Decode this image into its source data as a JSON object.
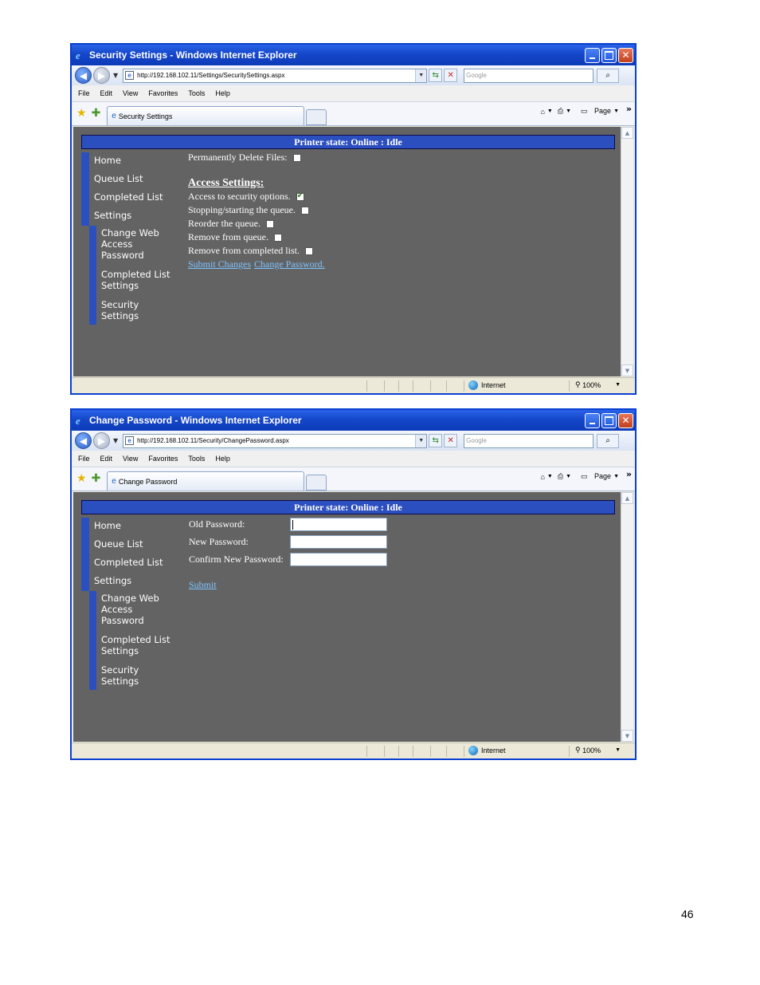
{
  "colors": {
    "title_bar": "#1547c9",
    "page_background": "#636363",
    "accent_blue": "#2c4fc0",
    "link": "#7ec3ff"
  },
  "windows": [
    {
      "title": "Security Settings - Windows Internet Explorer",
      "url": "http://192.168.102.11/Settings/SecuritySettings.aspx",
      "search_placeholder": "Google",
      "menu": [
        "File",
        "Edit",
        "View",
        "Favorites",
        "Tools",
        "Help"
      ],
      "tab_label": "Security Settings",
      "page_menu": "Page",
      "printer_state": "Printer state: Online : Idle",
      "nav": {
        "items": [
          "Home",
          "Queue List",
          "Completed List",
          "Settings"
        ],
        "sub_items": [
          "Change Web Access Password",
          "Completed List Settings",
          "Security Settings"
        ]
      },
      "content": {
        "permanent_delete_label": "Permanently Delete Files:",
        "permanent_delete_checked": false,
        "access_title": "Access Settings:",
        "options": [
          {
            "label": "Access to security options.",
            "checked": true
          },
          {
            "label": "Stopping/starting the queue.",
            "checked": false
          },
          {
            "label": "Reorder the queue.",
            "checked": false
          },
          {
            "label": "Remove from queue.",
            "checked": false
          },
          {
            "label": "Remove from completed list.",
            "checked": false
          }
        ],
        "submit_link": "Submit Changes",
        "change_password_link": "Change Password."
      },
      "status": {
        "zone": "Internet",
        "zoom": "100%"
      }
    },
    {
      "title": "Change Password - Windows Internet Explorer",
      "url": "http://192.168.102.11/Security/ChangePassword.aspx",
      "search_placeholder": "Google",
      "menu": [
        "File",
        "Edit",
        "View",
        "Favorites",
        "Tools",
        "Help"
      ],
      "tab_label": "Change Password",
      "page_menu": "Page",
      "printer_state": "Printer state: Online : Idle",
      "nav": {
        "items": [
          "Home",
          "Queue List",
          "Completed List",
          "Settings"
        ],
        "sub_items": [
          "Change Web Access Password",
          "Completed List Settings",
          "Security Settings"
        ]
      },
      "form": {
        "old_password_label": "Old Password:",
        "new_password_label": "New Password:",
        "confirm_password_label": "Confirm New Password:",
        "submit_link": "Submit"
      },
      "status": {
        "zone": "Internet",
        "zoom": "100%"
      }
    }
  ],
  "page_number": "46"
}
